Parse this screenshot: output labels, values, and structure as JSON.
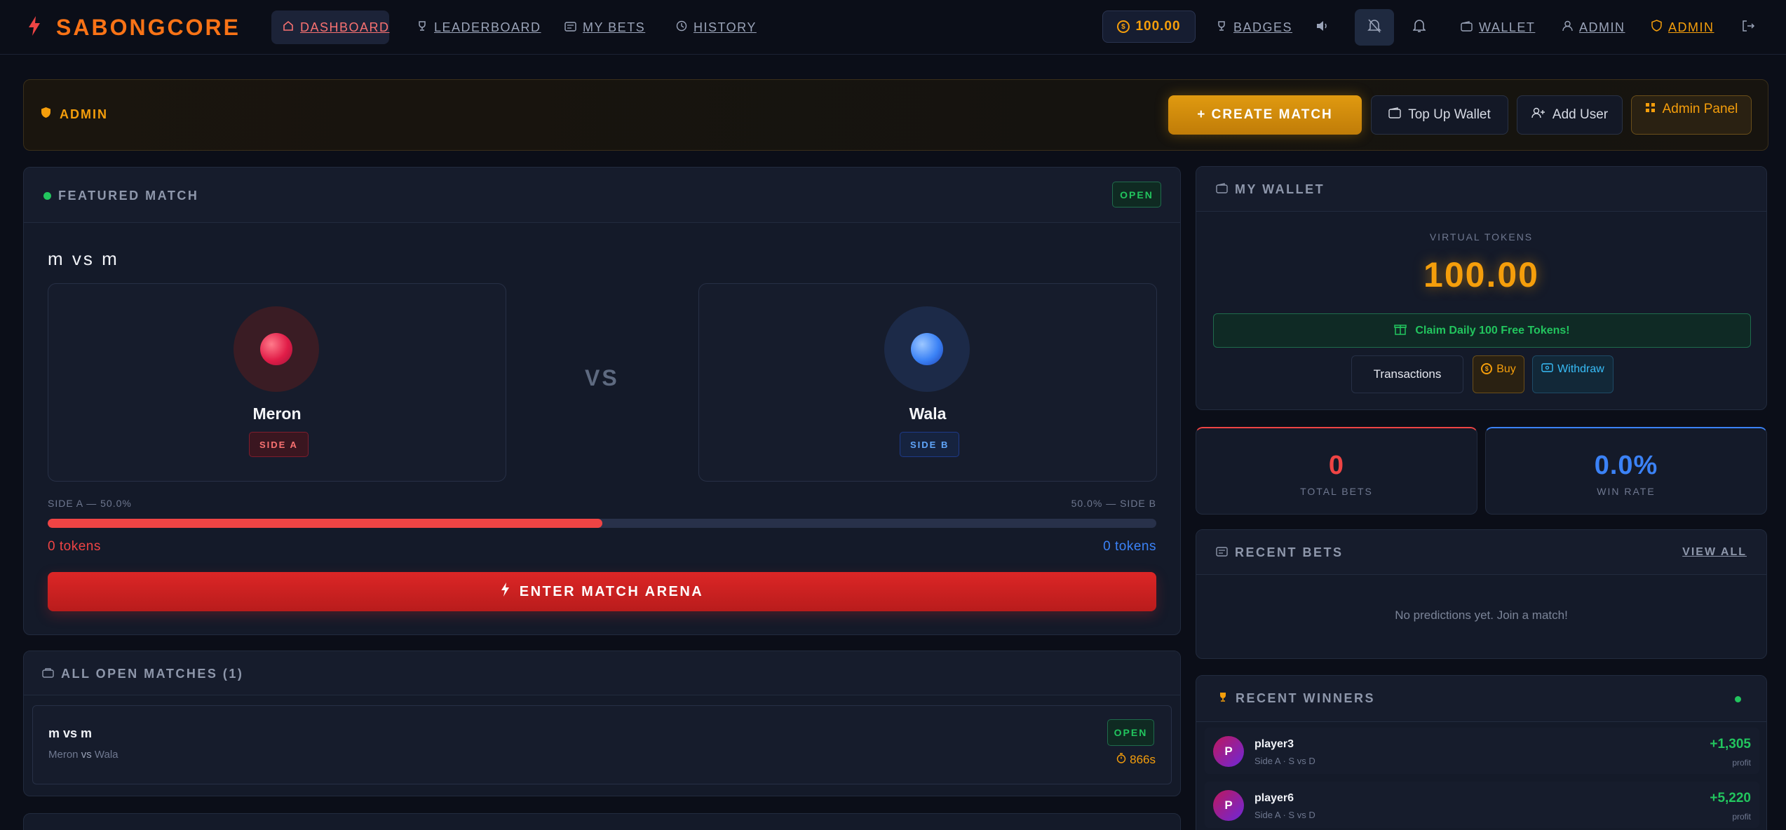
{
  "nav": {
    "brand": "SABONGCORE",
    "links": [
      {
        "label": "DASHBOARD"
      },
      {
        "label": "LEADERBOARD"
      },
      {
        "label": "MY BETS"
      },
      {
        "label": "HISTORY"
      }
    ],
    "wallet_balance": "100.00",
    "badges": "BADGES",
    "wallet": "WALLET",
    "admin_user": "ADMIN",
    "admin_link": "ADMIN"
  },
  "admin_bar": {
    "label": "ADMIN",
    "create_match": "+ CREATE MATCH",
    "top_up": "Top Up Wallet",
    "add_user": "Add User",
    "admin_panel": "Admin Panel"
  },
  "featured": {
    "header": "FEATURED MATCH",
    "status": "OPEN",
    "title": "m vs m",
    "vs": "VS",
    "side_a": {
      "name": "Meron",
      "tag": "SIDE A",
      "pct_label": "SIDE A — 50.0%",
      "tokens": "0 tokens",
      "share": 0.5
    },
    "side_b": {
      "name": "Wala",
      "tag": "SIDE B",
      "pct_label": "50.0% — SIDE B",
      "tokens": "0 tokens"
    },
    "enter_button": "ENTER MATCH ARENA"
  },
  "open_matches": {
    "header": "ALL OPEN MATCHES (1)",
    "items": [
      {
        "title": "m vs m",
        "side_a": "Meron",
        "vs": "vs",
        "side_b": "Wala",
        "status": "OPEN",
        "timer": "866s"
      }
    ]
  },
  "wallet": {
    "header": "MY WALLET",
    "virtual_label": "VIRTUAL TOKENS",
    "balance": "100.00",
    "claim": "Claim Daily 100 Free Tokens!",
    "transactions": "Transactions",
    "buy": "Buy",
    "withdraw": "Withdraw"
  },
  "stats": {
    "total_bets_value": "0",
    "total_bets_label": "TOTAL BETS",
    "win_rate_value": "0.0%",
    "win_rate_label": "WIN RATE"
  },
  "recent_bets": {
    "header": "RECENT BETS",
    "view_all": "VIEW ALL",
    "empty": "No predictions yet. Join a match!"
  },
  "recent_winners": {
    "header": "RECENT WINNERS",
    "items": [
      {
        "initial": "P",
        "name": "player3",
        "detail": "Side A · S vs D",
        "amount": "+1,305",
        "unit": "profit"
      },
      {
        "initial": "P",
        "name": "player6",
        "detail": "Side A · S vs D",
        "amount": "+5,220",
        "unit": "profit"
      }
    ]
  },
  "colors": {
    "accent_orange": "#f97316",
    "gold": "#f59e0b",
    "side_a_red": "#ef4444",
    "side_b_blue": "#3b82f6",
    "success_green": "#22c55e"
  }
}
